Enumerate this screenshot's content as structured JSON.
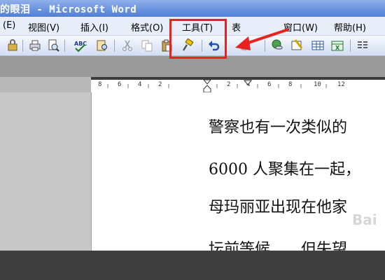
{
  "window": {
    "title": "的眼泪 - Microsoft Word"
  },
  "menubar": {
    "items": [
      {
        "label": "(E)"
      },
      {
        "label": "视图(V)"
      },
      {
        "label": "插入(I)"
      },
      {
        "label": "格式(O)"
      },
      {
        "label": "工具(T)"
      },
      {
        "label": "表"
      },
      {
        "label": "窗口(W)"
      },
      {
        "label": "帮助(H)"
      }
    ]
  },
  "toolbar": {
    "buttons": [
      {
        "icon": "permission-icon"
      },
      {
        "icon": "print-icon"
      },
      {
        "icon": "print-preview-icon"
      },
      {
        "icon": "spelling-icon"
      },
      {
        "icon": "research-icon"
      },
      {
        "icon": "cut-icon"
      },
      {
        "icon": "copy-icon"
      },
      {
        "icon": "paste-icon"
      },
      {
        "icon": "format-painter-icon"
      },
      {
        "icon": "undo-icon"
      },
      {
        "icon": "redo-icon"
      },
      {
        "icon": "hyperlink-icon"
      },
      {
        "icon": "tables-borders-icon"
      },
      {
        "icon": "insert-table-icon"
      },
      {
        "icon": "insert-excel-icon"
      },
      {
        "icon": "columns-icon"
      }
    ]
  },
  "ruler": {
    "labels": [
      "8",
      "6",
      "4",
      "2",
      "2",
      "4",
      "6",
      "8",
      "10",
      "12"
    ]
  },
  "document": {
    "lines": [
      "警察也有一次类似的",
      "6000 人聚集在一起，",
      "母玛丽亚出现在他家",
      "坛前等候，，，但失望"
    ]
  },
  "annotation": {
    "highlight_color": "#e8231f",
    "target": "工具(T)"
  },
  "watermark": {
    "text": "Bai"
  }
}
